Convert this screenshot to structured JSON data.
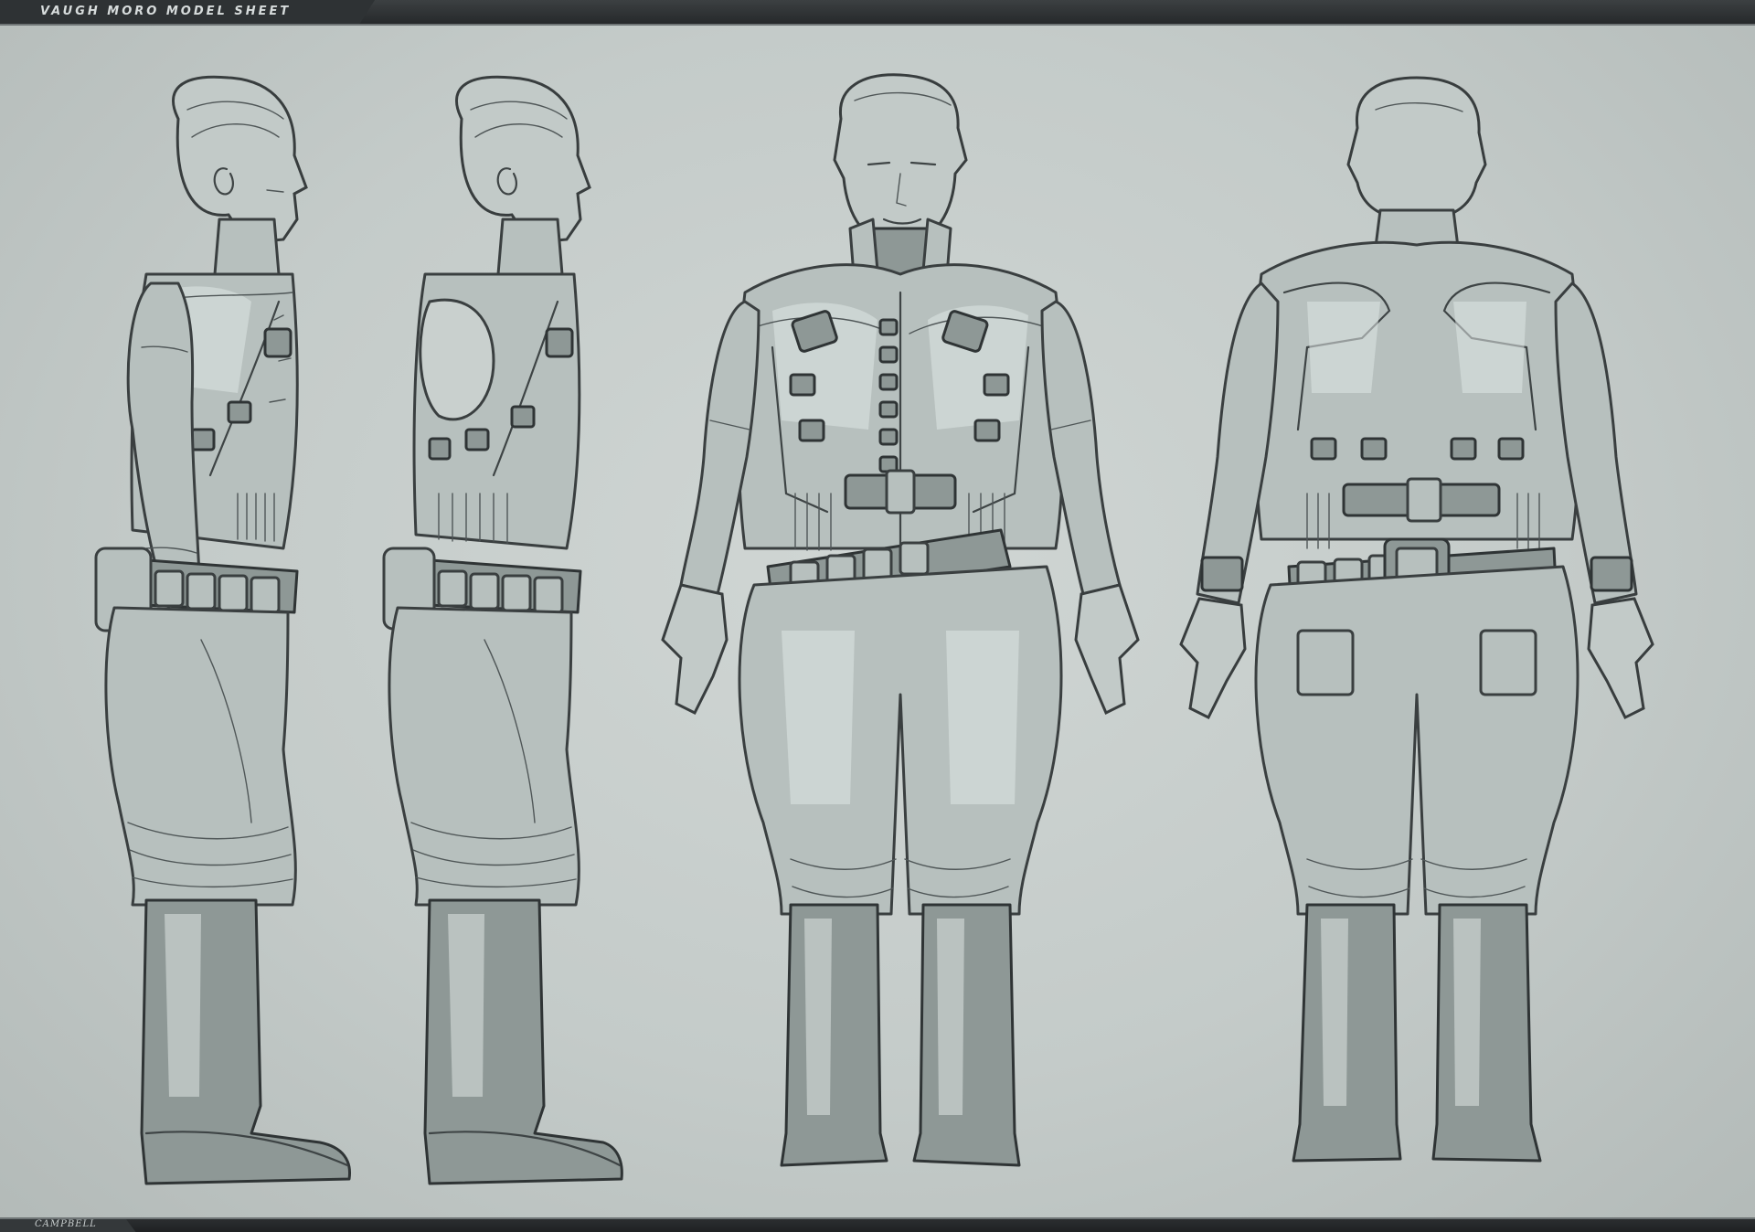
{
  "sheet": {
    "title": "VAUGH MORO MODEL SHEET",
    "signature": "CAMPBELL"
  },
  "colors": {
    "background": "#c4cbc9",
    "bar": "#2b2e30",
    "figure_fill": "#b7c0be",
    "ink": "#3a3f40"
  },
  "views": [
    {
      "name": "side-profile-view"
    },
    {
      "name": "side-profile-view-alternate"
    },
    {
      "name": "front-view"
    },
    {
      "name": "back-view"
    }
  ]
}
